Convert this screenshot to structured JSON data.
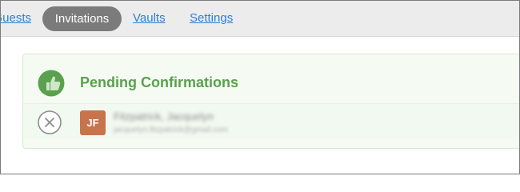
{
  "nav": {
    "items": [
      {
        "label": "Guests",
        "active": false
      },
      {
        "label": "Invitations",
        "active": true
      },
      {
        "label": "Vaults",
        "active": false
      },
      {
        "label": "Settings",
        "active": false
      }
    ]
  },
  "panel": {
    "title": "Pending Confirmations",
    "icon": "thumbs-up-icon",
    "rows": [
      {
        "avatar_initials": "JF",
        "name": "Fitzpatrick, Jacquelyn",
        "email": "jacquelyn.fitzpatrick@gmail.com",
        "action_icon": "close-circle-icon"
      }
    ]
  },
  "colors": {
    "nav_active_bg": "#7b7b7b",
    "link": "#2f7fd0",
    "title_green": "#5aa04e",
    "avatar_bg": "#c8734c"
  }
}
